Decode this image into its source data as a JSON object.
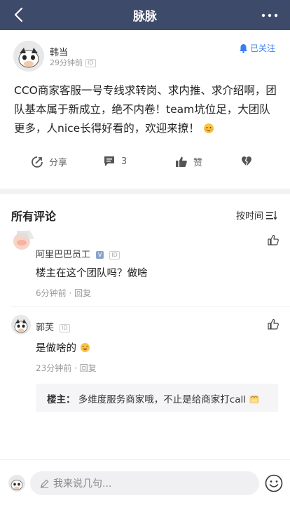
{
  "navbar": {
    "title": "脉脉"
  },
  "post": {
    "author": "韩当",
    "time": "29分钟前",
    "id_badge": "ID",
    "follow_label": "已关注",
    "text": "CCO商家客服一号专线求转岗、求内推、求介绍啊，团队基本属于新成立，绝不内卷！team坑位足，大团队更多，人nice长得好看的，欢迎来撩！",
    "actions": {
      "share": "分享",
      "comment_count": "3",
      "like": "赞"
    }
  },
  "comments_section": {
    "title": "所有评论",
    "sort_label": "按时间",
    "items": [
      {
        "name": "阿里巴巴员工",
        "verified_badge": "V",
        "id_badge": "ID",
        "text": "楼主在这个团队吗？做啥",
        "time": "6分钟前",
        "reply_label": "回复"
      },
      {
        "name": "郭芙",
        "id_badge": "ID",
        "text": "是做啥的",
        "time": "23分钟前",
        "reply_label": "回复",
        "reply": {
          "author": "楼主：",
          "text": "多维度服务商家哦，不止是给商家打call"
        }
      }
    ]
  },
  "bottom_bar": {
    "input_placeholder": "我来说几句..."
  },
  "colors": {
    "navbar": "#3d4a6a",
    "accent": "#3a7ef0",
    "muted": "#999999"
  }
}
